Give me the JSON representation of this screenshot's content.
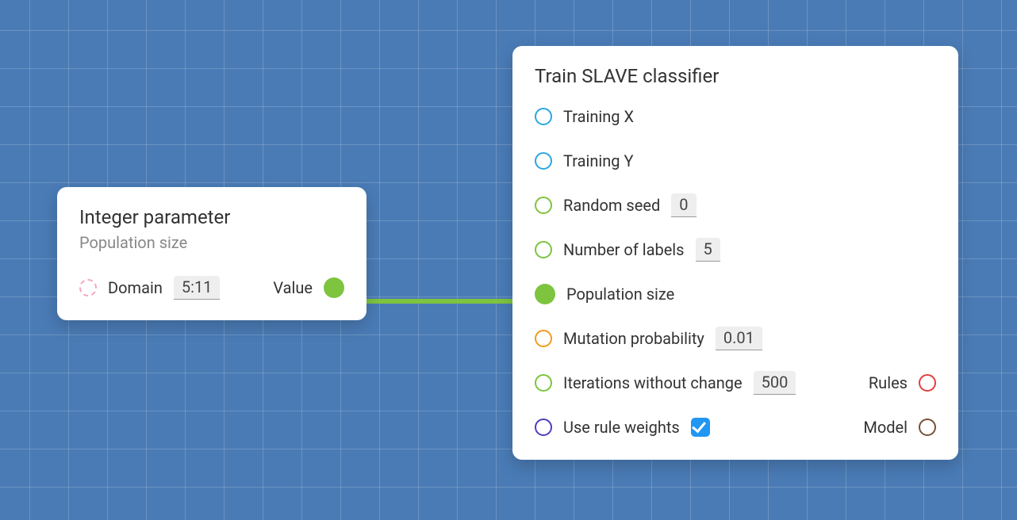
{
  "nodes": {
    "intParam": {
      "title": "Integer parameter",
      "subtitle": "Population size",
      "domainLabel": "Domain",
      "domainValue": "5:11",
      "valueLabel": "Value"
    },
    "train": {
      "title": "Train SLAVE classifier",
      "trainingX": "Training X",
      "trainingY": "Training Y",
      "randomSeedLabel": "Random seed",
      "randomSeedValue": "0",
      "numLabelsLabel": "Number of labels",
      "numLabelsValue": "5",
      "populationSize": "Population size",
      "mutationProbLabel": "Mutation probability",
      "mutationProbValue": "0.01",
      "iterNoChangeLabel": "Iterations without change",
      "iterNoChangeValue": "500",
      "useRuleWeightsLabel": "Use rule weights",
      "useRuleWeightsChecked": true,
      "rulesLabel": "Rules",
      "modelLabel": "Model"
    }
  },
  "colors": {
    "bg": "#4a7bb5",
    "wire": "#7ec43f"
  }
}
